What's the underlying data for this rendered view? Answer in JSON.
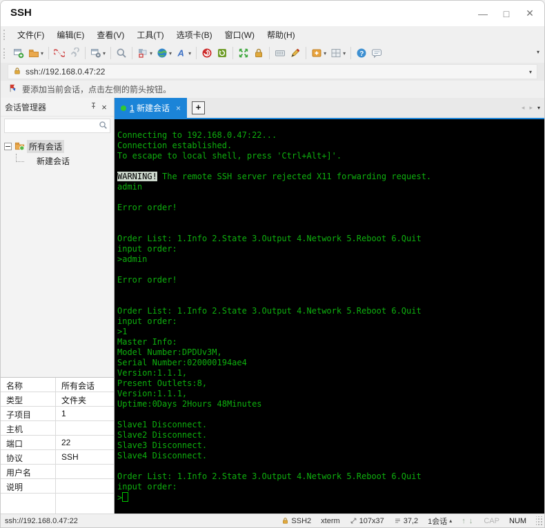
{
  "window": {
    "title": "SSH"
  },
  "icons": {
    "minimize": "—",
    "maximize": "□",
    "close": "✕",
    "close_small": "×",
    "dropdown": "▾",
    "overflow": "▾",
    "plus": "+",
    "tab_prev": "◂",
    "tab_next": "▸",
    "session_up": "▴",
    "arrow_up": "↑",
    "arrow_down": "↓"
  },
  "menu": {
    "items": [
      "文件(F)",
      "编辑(E)",
      "查看(V)",
      "工具(T)",
      "选项卡(B)",
      "窗口(W)",
      "帮助(H)"
    ]
  },
  "toolbar": {
    "items": [
      {
        "name": "new-session-icon",
        "shape": "window-plus",
        "dropdown": false,
        "sep_after": false
      },
      {
        "name": "open-folder-icon",
        "shape": "folder",
        "dropdown": true,
        "sep_after": true
      },
      {
        "name": "disconnect-icon",
        "shape": "chain-broken",
        "dropdown": false,
        "sep_after": false
      },
      {
        "name": "reconnect-icon",
        "shape": "chain",
        "dropdown": false,
        "sep_after": true
      },
      {
        "name": "session-properties-icon",
        "shape": "window-gear",
        "dropdown": true,
        "sep_after": true
      },
      {
        "name": "find-icon",
        "shape": "magnifier",
        "dropdown": false,
        "sep_after": true
      },
      {
        "name": "compose-icon",
        "shape": "squares",
        "dropdown": true,
        "sep_after": false
      },
      {
        "name": "web-icon",
        "shape": "globe",
        "dropdown": true,
        "sep_after": false
      },
      {
        "name": "font-icon",
        "shape": "font-a",
        "dropdown": true,
        "sep_after": true
      },
      {
        "name": "xagent-icon",
        "shape": "swirl",
        "dropdown": false,
        "sep_after": false
      },
      {
        "name": "update-icon",
        "shape": "shield-refresh",
        "dropdown": false,
        "sep_after": true
      },
      {
        "name": "fullscreen-icon",
        "shape": "arrows-out",
        "dropdown": false,
        "sep_after": false
      },
      {
        "name": "lock-screen-icon",
        "shape": "padlock",
        "dropdown": false,
        "sep_after": true
      },
      {
        "name": "virtual-keyboard-icon",
        "shape": "keyboard",
        "dropdown": false,
        "sep_after": false
      },
      {
        "name": "highlighter-icon",
        "shape": "pen",
        "dropdown": false,
        "sep_after": true
      },
      {
        "name": "new-file-icon",
        "shape": "box-plus",
        "dropdown": true,
        "sep_after": false
      },
      {
        "name": "layout-icon",
        "shape": "grid",
        "dropdown": true,
        "sep_after": true
      },
      {
        "name": "help-icon",
        "shape": "help",
        "dropdown": false,
        "sep_after": false
      },
      {
        "name": "message-icon",
        "shape": "bubble",
        "dropdown": false,
        "sep_after": false
      }
    ]
  },
  "address_bar": {
    "value": "ssh://192.168.0.47:22"
  },
  "notice_bar": {
    "text": "要添加当前会话，点击左侧的箭头按钮。"
  },
  "sidebar": {
    "title": "会话管理器",
    "search_value": "",
    "tree": {
      "root": "所有会话",
      "child": "新建会话"
    },
    "properties": [
      {
        "label": "名称",
        "value": "所有会话"
      },
      {
        "label": "类型",
        "value": "文件夹"
      },
      {
        "label": "子项目",
        "value": "1"
      },
      {
        "label": "主机",
        "value": ""
      },
      {
        "label": "端口",
        "value": "22"
      },
      {
        "label": "协议",
        "value": "SSH"
      },
      {
        "label": "用户名",
        "value": ""
      },
      {
        "label": "说明",
        "value": ""
      }
    ]
  },
  "terminal": {
    "tab": {
      "index": "1",
      "label": "新建会话"
    },
    "colors": {
      "background": "#000000",
      "text": "#0eb00e",
      "tab_active": "#1b84d8",
      "cursor": "#00c800"
    },
    "lines": [
      {
        "text": "Connecting to 192.168.0.47:22..."
      },
      {
        "text": "Connection established."
      },
      {
        "text": "To escape to local shell, press 'Ctrl+Alt+]'."
      },
      {
        "text": ""
      },
      {
        "inverse": "WARNING!",
        "text": " The remote SSH server rejected X11 forwarding request."
      },
      {
        "text": "admin"
      },
      {
        "text": ""
      },
      {
        "text": "Error order!"
      },
      {
        "text": ""
      },
      {
        "text": ""
      },
      {
        "text": "Order List: 1.Info 2.State 3.Output 4.Network 5.Reboot 6.Quit"
      },
      {
        "text": "input order:"
      },
      {
        "text": ">admin"
      },
      {
        "text": ""
      },
      {
        "text": "Error order!"
      },
      {
        "text": ""
      },
      {
        "text": ""
      },
      {
        "text": "Order List: 1.Info 2.State 3.Output 4.Network 5.Reboot 6.Quit"
      },
      {
        "text": "input order:"
      },
      {
        "text": ">1"
      },
      {
        "text": "Master Info:"
      },
      {
        "text": "Model Number:DPDUv3M,"
      },
      {
        "text": "Serial Number:020000194ae4"
      },
      {
        "text": "Version:1.1.1,"
      },
      {
        "text": "Present Outlets:8,"
      },
      {
        "text": "Version:1.1.1,"
      },
      {
        "text": "Uptime:0Days 2Hours 48Minutes"
      },
      {
        "text": ""
      },
      {
        "text": "Slave1 Disconnect."
      },
      {
        "text": "Slave2 Disconnect."
      },
      {
        "text": "Slave3 Disconnect."
      },
      {
        "text": "Slave4 Disconnect."
      },
      {
        "text": ""
      },
      {
        "text": "Order List: 1.Info 2.State 3.Output 4.Network 5.Reboot 6.Quit"
      },
      {
        "text": "input order:"
      },
      {
        "text": ">",
        "cursor": true
      }
    ]
  },
  "status_bar": {
    "address": "ssh://192.168.0.47:22",
    "encryption": "SSH2",
    "terminal_type": "xterm",
    "terminal_size": "107x37",
    "cursor_position": "37,2",
    "session_count": "1会话",
    "caps_indicator": "CAP",
    "num_indicator": "NUM"
  }
}
